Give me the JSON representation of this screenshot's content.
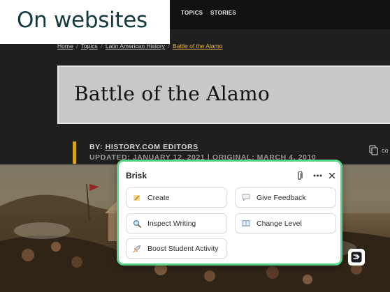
{
  "badge": {
    "text": "On websites"
  },
  "nav": {
    "links": [
      "TOPICS",
      "STORIES"
    ]
  },
  "breadcrumb": {
    "items": [
      "Home",
      "Topics",
      "Latin American History",
      "Battle of the Alamo"
    ],
    "separator": "/"
  },
  "article": {
    "title": "Battle of the Alamo",
    "byline_prefix": "BY:",
    "author": "HISTORY.COM EDITORS",
    "updated": "UPDATED: JANUARY 12, 2021 | ORIGINAL: MARCH 4, 2010",
    "copy_label": "co"
  },
  "brisk": {
    "title": "Brisk",
    "header_icons": [
      "paperclip-icon",
      "more-icon",
      "close-icon"
    ],
    "actions": [
      {
        "label": "Create",
        "icon": "pencil-icon"
      },
      {
        "label": "Give Feedback",
        "icon": "speech-bubble-icon"
      },
      {
        "label": "Inspect Writing",
        "icon": "magnifier-icon"
      },
      {
        "label": "Change Level",
        "icon": "book-icon"
      },
      {
        "label": "Boost Student Activity",
        "icon": "rocket-icon"
      }
    ]
  },
  "colors": {
    "badge_text": "#123a3f",
    "panel_border": "#5bd58a",
    "breadcrumb_current": "#e9b846",
    "byline_accent": "#d8a31f"
  }
}
